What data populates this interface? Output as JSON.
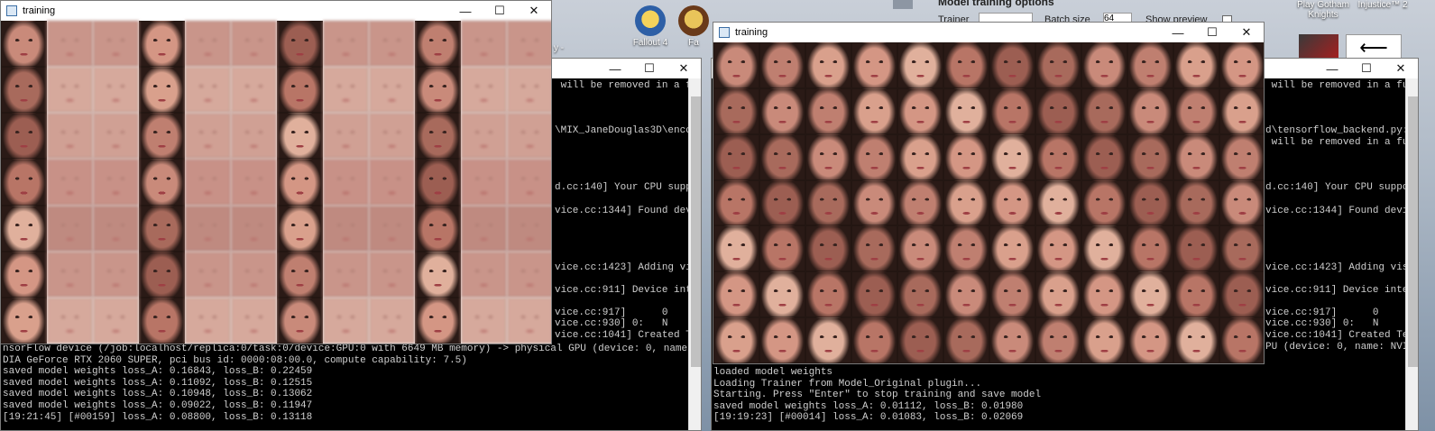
{
  "desktop": {
    "top_menu_text": "Model training options",
    "trainer_label": "Trainer",
    "batch_label": "Batch size",
    "batch_value": "64",
    "preview_label": "Show preview",
    "icons": [
      {
        "label": "Fallout 4",
        "icon": "fallout-vault-boy-icon"
      },
      {
        "label": "Fa",
        "icon": "game-icon"
      },
      {
        "label": "Play Gotham Knights",
        "icon": "game-icon"
      },
      {
        "label": "Injustice™ 2",
        "icon": "game-icon"
      }
    ],
    "left_partial_label": "y -"
  },
  "console_left": {
    "lines": [
      " will be removed in a fu",
      "",
      "",
      "",
      "\\MIX_JaneDouglas3D\\encod",
      "",
      "",
      "",
      "",
      "d.cc:140] Your CPU suppo",
      "",
      "vice.cc:1344] Found devi",
      "",
      "",
      "",
      "",
      "vice.cc:1423] Adding vis",
      "",
      "vice.cc:911] Device inte",
      "",
      "vice.cc:917]      0",
      "vice.cc:930] 0:   N",
      "vice.cc:1041] Created Te"
    ],
    "bottom_lines": [
      "nsorFlow device (/job:localhost/replica:0/task:0/device:GPU:0 with 6649 MB memory) -> physical GPU (device: 0, name: NVI",
      "DIA GeForce RTX 2060 SUPER, pci bus id: 0000:08:00.0, compute capability: 7.5)",
      "saved model weights loss_A: 0.16843, loss_B: 0.22459",
      "saved model weights loss_A: 0.11092, loss_B: 0.12515",
      "saved model weights loss_A: 0.10948, loss_B: 0.13062",
      "saved model weights loss_A: 0.09022, loss_B: 0.11947",
      "[19:21:45] [#00159] loss_A: 0.08800, loss_B: 0.13118"
    ]
  },
  "console_right": {
    "lines": [
      " will be removed in a fu",
      "",
      "",
      "",
      "d\\tensorflow_backend.py:",
      " will be removed in a fu",
      "",
      "",
      "",
      "d.cc:140] Your CPU suppo",
      "",
      "vice.cc:1344] Found devi",
      "",
      "",
      "",
      "",
      "vice.cc:1423] Adding vis",
      "",
      "vice.cc:911] Device inte",
      "",
      "vice.cc:917]      0",
      "vice.cc:930] 0:   N",
      "vice.cc:1041] Created Te",
      "PU (device: 0, name: NVI"
    ],
    "bottom_lines": [
      "loaded model weights",
      "Loading Trainer from Model_Original plugin...",
      "Starting. Press \"Enter\" to stop training and save model",
      "saved model weights loss_A: 0.01112, loss_B: 0.01980",
      "[19:19:23] [#00014] loss_A: 0.01083, loss_B: 0.02069"
    ]
  },
  "training_left": {
    "title": "training",
    "rows": 7,
    "cols": 12
  },
  "training_right": {
    "title": "training",
    "rows": 7,
    "cols": 12
  },
  "window_controls": {
    "minimize": "—",
    "maximize": "☐",
    "close": "✕"
  },
  "colors": {
    "skin_sharp": [
      "#c98a7a",
      "#b87566",
      "#d9a08c",
      "#a86a5c",
      "#e0b09c",
      "#bf7f70",
      "#9c5e52",
      "#d49684"
    ],
    "skin_blurry": [
      "#c9958a",
      "#d0a094",
      "#bf8a80",
      "#d6a99c",
      "#c89187"
    ]
  }
}
